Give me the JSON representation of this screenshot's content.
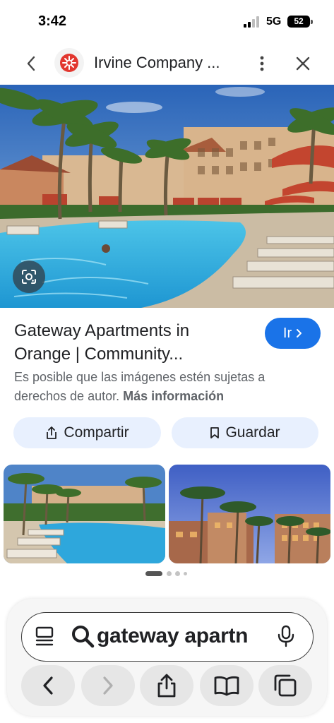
{
  "status_bar": {
    "time": "3:42",
    "network": "5G",
    "battery": "52"
  },
  "header": {
    "title": "Irvine Company ...",
    "logo_color": "#e2372f"
  },
  "result": {
    "title_line1": "Gateway Apartments in",
    "title_line2": "Orange | Community...",
    "go_label": "Ir",
    "copyright_text": "Es posible que las imágenes estén sujetas a derechos de autor.",
    "more_info_label": "Más información"
  },
  "actions": {
    "share_label": "Compartir",
    "save_label": "Guardar"
  },
  "carousel": {
    "page": 1,
    "pages": 4
  },
  "browser": {
    "url_text": "gateway apartn"
  },
  "colors": {
    "accent": "#1a73e8",
    "chip_bg": "#e8f0fe"
  },
  "icons": {
    "back": "chevron-left-icon",
    "menu": "more-vert-icon",
    "close": "close-icon",
    "lens": "google-lens-icon",
    "share": "share-icon",
    "save": "bookmark-icon",
    "tabs": "tabs-icon",
    "search": "search-icon",
    "mic": "microphone-icon"
  }
}
